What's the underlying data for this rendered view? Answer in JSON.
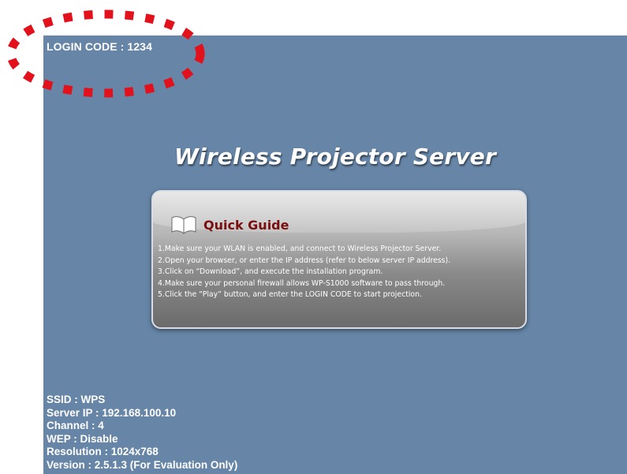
{
  "header": {
    "login_code": "LOGIN CODE : 1234"
  },
  "main": {
    "title": "Wireless Projector Server"
  },
  "quick_guide": {
    "title": "Quick Guide",
    "steps": [
      "1.Make sure your WLAN is enabled, and connect to Wireless Projector Server.",
      "2.Open your browser, or enter the IP address (refer to below server IP address).",
      "3.Click on “Download”, and execute the installation program.",
      "4.Make sure your personal firewall allows WP-S1000 software to pass through.",
      "5.Click the “Play” button, and enter the LOGIN CODE to start projection."
    ]
  },
  "info": {
    "ssid": "SSID : WPS",
    "server_ip": "Server IP : 192.168.100.10",
    "channel": "Channel : 4",
    "wep": "WEP : Disable",
    "resolution": "Resolution : 1024x768",
    "version": "Version : 2.5.1.3 (For Evaluation Only)"
  },
  "colors": {
    "background": "#6685a7",
    "guide_title": "#7a0e0e",
    "annotation": "#e3111b"
  },
  "icons": {
    "guide": "open-book-icon"
  }
}
